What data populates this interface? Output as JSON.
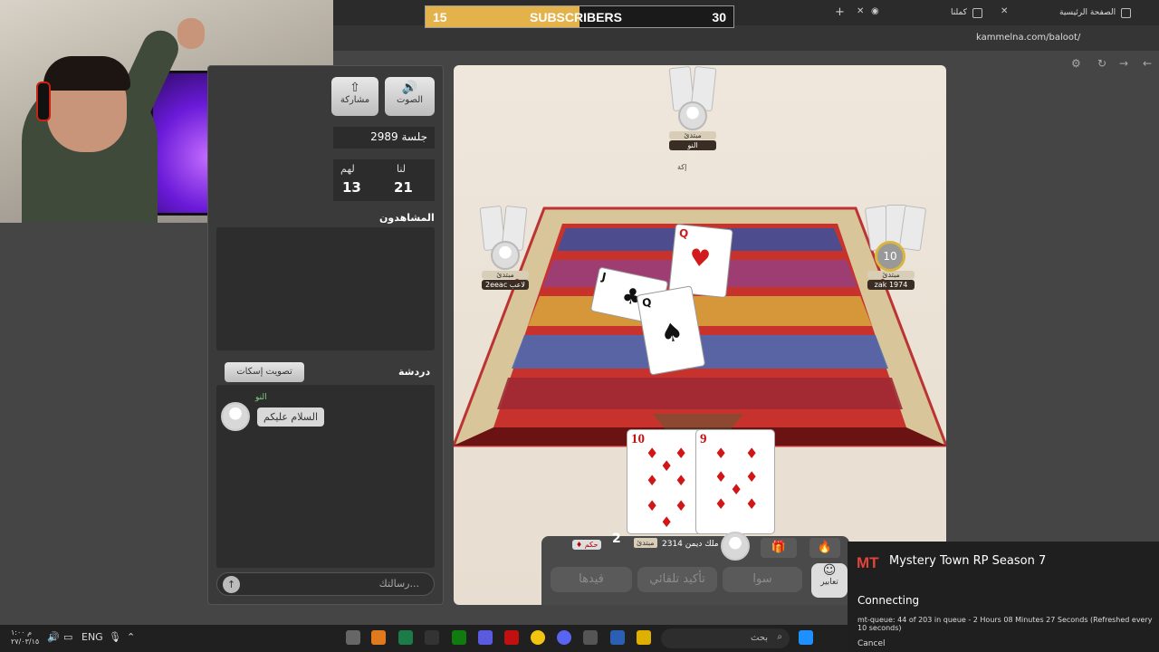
{
  "browser": {
    "tabs": [
      {
        "label": "الصفحة الرئيسية"
      },
      {
        "label": "كملنا"
      }
    ],
    "url": "kammelna.com/baloot/"
  },
  "overlay": {
    "subscribers_label": "SUBSCRIBERS",
    "current": "15",
    "goal": "30",
    "progress": 0.5,
    "bar_color": "#e3b24a"
  },
  "left_panel": {
    "sound_label": "الصوت",
    "share_label": "مشاركة",
    "session": "جلسة 2989",
    "score": {
      "us_label": "لنا",
      "us_value": "21",
      "them_label": "لهم",
      "them_value": "13"
    },
    "viewers_title": "المشاهدون",
    "chat_title": "دردشة",
    "mute_vote_label": "تصويت إسكات",
    "chat_messages": [
      {
        "name": "النو",
        "text": "السلام عليكم"
      }
    ],
    "message_placeholder": "رسالتك..."
  },
  "game": {
    "players": {
      "top": {
        "rank": "مبتدئ",
        "name": "النو",
        "note": "إكة"
      },
      "left": {
        "rank": "مبتدئ",
        "name": "2eeac لاعب"
      },
      "right": {
        "rank": "مبتدئ",
        "name": "zak 1974",
        "timer": "10"
      },
      "bottom": {
        "rank": "مبتدئ",
        "name": "ملك ديمن 2314",
        "tag": "حكم",
        "count": "2"
      }
    },
    "hand": [
      {
        "rank": "10",
        "suit": "diamonds"
      },
      {
        "rank": "9",
        "suit": "diamonds"
      }
    ],
    "table_cards": [
      {
        "rank": "Q",
        "suit": "hearts"
      },
      {
        "rank": "J",
        "suit": "clubs"
      },
      {
        "rank": "Q",
        "suit": "spades"
      }
    ],
    "actions": {
      "emote_label": "تعابير",
      "sawa_label": "سوا",
      "auto_confirm_label": "تأكيد تلقائي",
      "record_label": "قيدها"
    }
  },
  "toast": {
    "title": "Mystery Town RP Season 7",
    "logo": "MT",
    "status": "Connecting",
    "detail": "mt-queue: 44 of 203 in queue - 2 Hours 08 Minutes 27 Seconds (Refreshed every 10 seconds)",
    "cancel": "Cancel"
  },
  "taskbar": {
    "time": "م ١:٠٠",
    "date": "٢٧/٠٣/١٥",
    "lang": "ENG",
    "search_placeholder": "بحث"
  }
}
